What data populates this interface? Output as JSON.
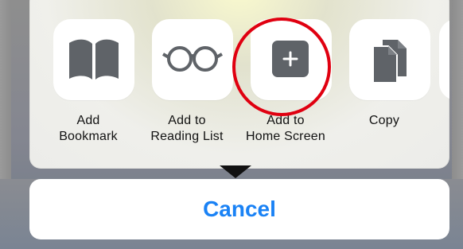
{
  "share_sheet": {
    "actions": [
      {
        "label_line1": "Add",
        "label_line2": "Bookmark",
        "icon": "bookmark-icon"
      },
      {
        "label_line1": "Add to",
        "label_line2": "Reading List",
        "icon": "reading-list-icon"
      },
      {
        "label_line1": "Add to",
        "label_line2": "Home Screen",
        "icon": "add-to-home-screen-icon",
        "highlighted": true
      },
      {
        "label_line1": "Copy",
        "label_line2": "",
        "icon": "copy-icon"
      }
    ]
  },
  "cancel": {
    "label": "Cancel"
  },
  "colors": {
    "icon_gray": "#5f6368",
    "highlight_red": "#e00010",
    "accent_blue": "#1a82f5",
    "sheet_background": "#ecece9"
  }
}
